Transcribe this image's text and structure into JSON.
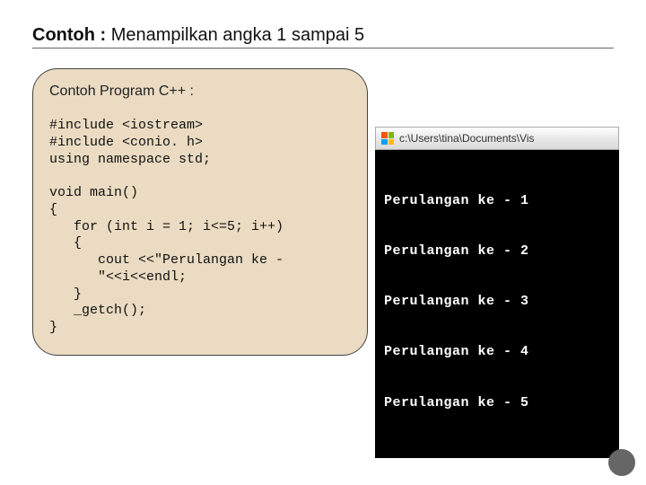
{
  "title": {
    "bold": "Contoh :",
    "rest": " Menampilkan angka 1 sampai 5"
  },
  "card": {
    "heading": "Contoh Program C++ :",
    "code": "#include <iostream>\n#include <conio. h>\nusing namespace std;\n\nvoid main()\n{\n   for (int i = 1; i<=5; i++)\n   {\n      cout <<\"Perulangan ke -\n      \"<<i<<endl;\n   }\n   _getch();\n}"
  },
  "output": {
    "titlebar": "c:\\Users\\tina\\Documents\\Vis",
    "lines": [
      "Perulangan ke - 1",
      "Perulangan ke - 2",
      "Perulangan ke - 3",
      "Perulangan ke - 4",
      "Perulangan ke - 5"
    ]
  }
}
